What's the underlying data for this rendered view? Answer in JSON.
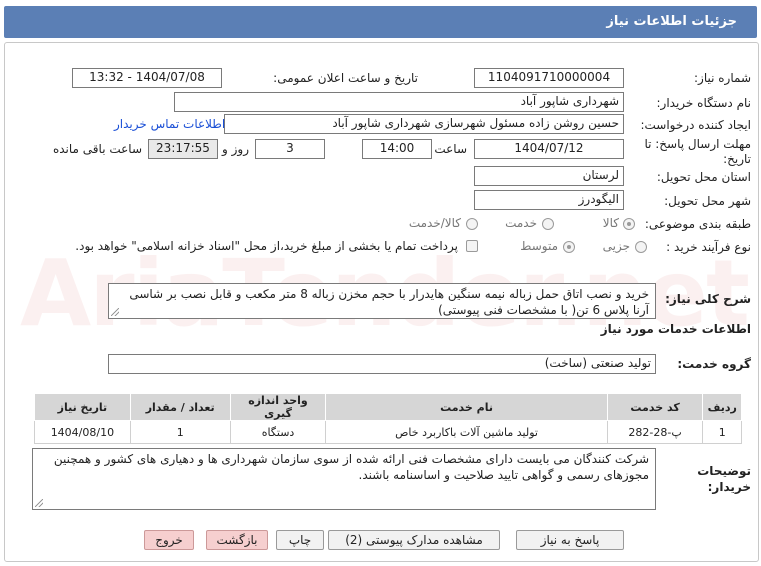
{
  "header": {
    "title": "جزئیات اطلاعات نیاز"
  },
  "fields": {
    "need_number_label": "شماره نیاز:",
    "need_number": "1104091710000004",
    "announce_label": "تاریخ و ساعت اعلان عمومی:",
    "announce_value": "1404/07/08 - 13:32",
    "buyer_org_label": "نام دستگاه خریدار:",
    "buyer_org": "شهرداری شاپور آباد",
    "creator_label": "ایجاد کننده درخواست:",
    "creator": "حسین روشن زاده مسئول شهرسازی شهرداری شاپور آباد",
    "contact_link": "اطلاعات تماس خریدار",
    "deadline_label": "مهلت ارسال پاسخ: تا تاریخ:",
    "deadline_date": "1404/07/12",
    "time_label": "ساعت",
    "deadline_time": "14:00",
    "days_value": "3",
    "days_label": "روز و",
    "remaining_time": "23:17:55",
    "remaining_label": "ساعت باقی مانده",
    "province_label": "استان محل تحویل:",
    "province": "لرستان",
    "city_label": "شهر محل تحویل:",
    "city": "الیگودرز",
    "category_label": "طبقه بندی موضوعی:",
    "cat_goods": "کالا",
    "cat_service": "خدمت",
    "cat_goods_service": "کالا/خدمت",
    "purchase_type_label": "نوع فرآیند خرید :",
    "pt_partial": "جزیی",
    "pt_medium": "متوسط",
    "payment_note": "پرداخت تمام یا بخشی از مبلغ خرید،از محل \"اسناد خزانه اسلامی\" خواهد بود."
  },
  "summary": {
    "label": "شرح کلی نیاز:",
    "text": "خرید و نصب اتاق حمل زباله نیمه سنگین هایدرار با حجم مخزن زباله 8 متر مکعب و قابل نصب بر شاسی آرنا پلاس 6 تن( با مشخصات فنی پیوستی)"
  },
  "services": {
    "section_title": "اطلاعات خدمات مورد نیاز",
    "group_label": "گروه خدمت:",
    "group_value": "تولید صنعتی (ساخت)",
    "columns": [
      "ردیف",
      "کد خدمت",
      "نام خدمت",
      "واحد اندازه گیری",
      "تعداد / مقدار",
      "تاریخ نیاز"
    ],
    "rows": [
      [
        "1",
        "پ-28-282",
        "تولید ماشین آلات باکاربرد خاص",
        "دستگاه",
        "1",
        "1404/08/10"
      ]
    ]
  },
  "notes": {
    "label": "توضیحات خریدار:",
    "text": "شرکت کنندگان می بایست دارای مشخصات فنی ارائه شده از سوی سازمان شهرداری ها و دهیاری های کشور و همچنین مجوزهای رسمی و گواهی تایید صلاحیت و اساسنامه باشند."
  },
  "buttons": {
    "reply": "پاسخ به نیاز",
    "view_docs": "مشاهده مدارک پیوستی (2)",
    "print": "چاپ",
    "back": "بازگشت",
    "exit": "خروج"
  },
  "watermark": "AriaTender.net",
  "colors": {
    "title_bar": "#5b7fb5",
    "link": "#1a4fd6",
    "red_button": "#f6cfcf"
  }
}
